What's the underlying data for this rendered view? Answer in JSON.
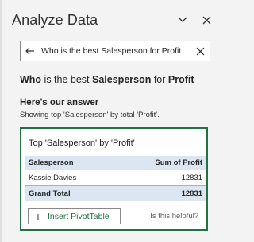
{
  "header": {
    "title": "Analyze Data",
    "icons": [
      "chevron-down-icon",
      "close-icon"
    ]
  },
  "search": {
    "value": "Who is the best Salesperson for Profit",
    "back_icon": "back-arrow-icon",
    "clear_icon": "close-icon"
  },
  "question": {
    "parts": [
      {
        "text": "Who",
        "bold": true
      },
      {
        "text": " is the best ",
        "bold": false
      },
      {
        "text": "Salesperson",
        "bold": true
      },
      {
        "text": " for ",
        "bold": false
      },
      {
        "text": "Profit",
        "bold": true
      }
    ]
  },
  "answer": {
    "heading": "Here's our answer",
    "subtext": "Showing top 'Salesperson' by total 'Profit'."
  },
  "card": {
    "title": "Top 'Salesperson' by 'Profit'",
    "table": {
      "headers": [
        "Salesperson",
        "Sum of Profit"
      ],
      "rows": [
        [
          "Kassie Davies",
          "12831"
        ]
      ],
      "total": [
        "Grand Total",
        "12831"
      ]
    },
    "insert_button": "Insert PivotTable",
    "helpful": "Is this helpful?"
  },
  "colors": {
    "accent": "#217346",
    "pivot_header": "#dce6f2",
    "background": "#f3f3f3"
  }
}
